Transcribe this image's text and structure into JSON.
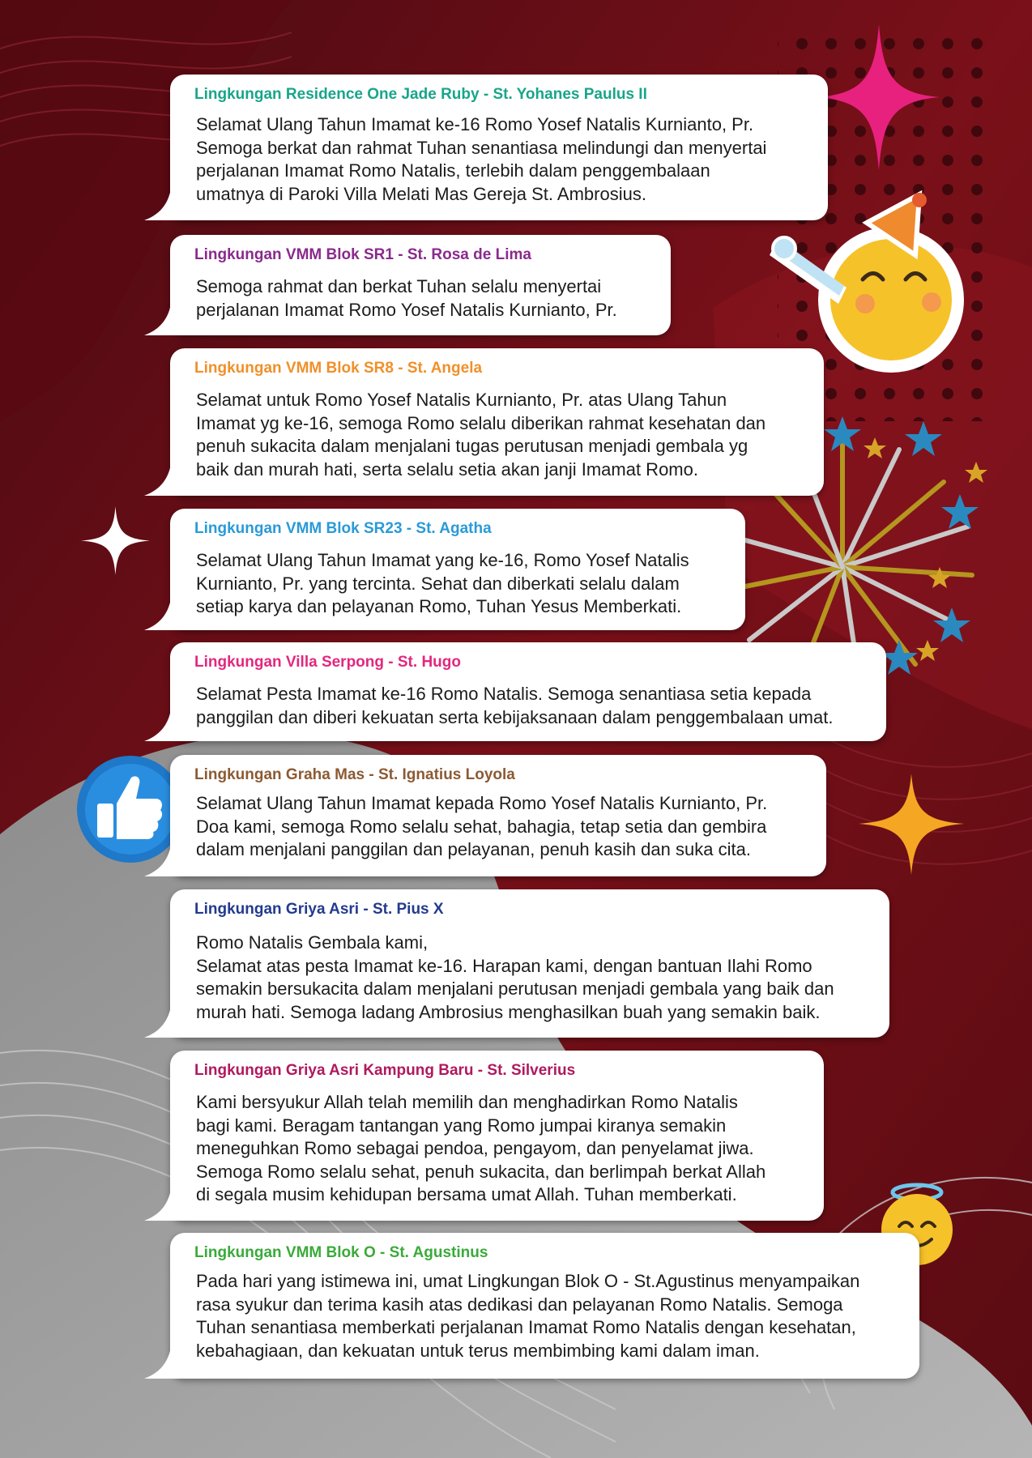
{
  "colors": {
    "background_red": "#6e0f17",
    "background_gray": "#9a9a9a",
    "bubble": "#ffffff",
    "message_text": "#1c1c1c",
    "sparkle_pink": "#e8217e",
    "sparkle_gold": "#f5a623"
  },
  "decorations": {
    "icons": [
      "sparkle-pink-icon",
      "party-emoji-icon",
      "fireworks-icon",
      "sparkle-white-icon",
      "thumbs-up-icon",
      "sparkle-gold-icon",
      "angel-emoji-icon"
    ]
  },
  "messages": [
    {
      "sender": "Lingkungan Residence One Jade Ruby - St. Yohanes Paulus II",
      "sender_color": "#18a58a",
      "text": "Selamat Ulang Tahun Imamat ke-16 Romo Yosef Natalis Kurnianto, Pr.\nSemoga berkat dan rahmat Tuhan senantiasa melindungi dan menyertai\nperjalanan Imamat Romo Natalis, terlebih dalam penggembalaan\numatnya di Paroki Villa Melati Mas Gereja St. Ambrosius."
    },
    {
      "sender": "Lingkungan VMM Blok SR1 - St. Rosa de Lima",
      "sender_color": "#8a2a8c",
      "text": "Semoga rahmat dan berkat Tuhan selalu menyertai\nperjalanan Imamat Romo Yosef Natalis Kurnianto, Pr."
    },
    {
      "sender": "Lingkungan VMM Blok SR8 - St. Angela",
      "sender_color": "#f0902a",
      "text": "Selamat untuk Romo Yosef Natalis Kurnianto, Pr. atas Ulang Tahun\nImamat yg ke-16, semoga Romo selalu diberikan rahmat kesehatan dan\npenuh sukacita dalam menjalani tugas perutusan menjadi gembala yg\nbaik dan murah hati, serta selalu setia akan janji Imamat Romo."
    },
    {
      "sender": "Lingkungan VMM Blok SR23 - St. Agatha",
      "sender_color": "#2a9ad8",
      "text": "Selamat Ulang Tahun Imamat yang ke-16, Romo Yosef Natalis\nKurnianto, Pr. yang tercinta. Sehat dan diberkati selalu dalam\nsetiap karya  dan pelayanan  Romo, Tuhan Yesus Memberkati."
    },
    {
      "sender": "Lingkungan Villa Serpong - St. Hugo",
      "sender_color": "#e3277f",
      "text": "Selamat Pesta Imamat ke-16 Romo Natalis. Semoga senantiasa setia kepada\npanggilan dan diberi kekuatan serta kebijaksanaan dalam penggembalaan umat."
    },
    {
      "sender": "Lingkungan Graha Mas - St. Ignatius Loyola",
      "sender_color": "#8c5a32",
      "text": "Selamat Ulang Tahun Imamat kepada Romo Yosef Natalis Kurnianto, Pr.\nDoa kami, semoga Romo selalu sehat, bahagia, tetap setia  dan gembira\ndalam menjalani panggilan dan pelayanan, penuh kasih dan suka cita."
    },
    {
      "sender": "Lingkungan Griya Asri - St. Pius X",
      "sender_color": "#233a8e",
      "text": "Romo Natalis Gembala kami,\nSelamat atas pesta Imamat ke-16. Harapan kami, dengan bantuan Ilahi Romo\nsemakin bersukacita dalam menjalani perutusan menjadi gembala yang baik dan\nmurah hati. Semoga ladang Ambrosius menghasilkan buah yang semakin baik."
    },
    {
      "sender": "Lingkungan Griya Asri Kampung Baru - St. Silverius",
      "sender_color": "#b0195e",
      "text": "Kami bersyukur Allah telah memilih dan menghadirkan Romo Natalis\nbagi kami. Beragam tantangan yang Romo jumpai kiranya semakin\nmeneguhkan Romo sebagai pendoa, pengayom, dan penyelamat jiwa.\nSemoga Romo selalu sehat, penuh sukacita, dan berlimpah berkat Allah\ndi segala musim kehidupan bersama umat Allah. Tuhan memberkati."
    },
    {
      "sender": "Lingkungan VMM Blok O - St. Agustinus",
      "sender_color": "#3aaa3a",
      "text": "Pada hari yang istimewa ini, umat Lingkungan Blok O - St.Agustinus menyampaikan\nrasa syukur dan terima kasih atas dedikasi dan pelayanan Romo Natalis. Semoga\nTuhan senantiasa memberkati perjalanan Imamat Romo Natalis dengan kesehatan,\nkebahagiaan, dan kekuatan untuk terus membimbing kami dalam iman."
    }
  ]
}
